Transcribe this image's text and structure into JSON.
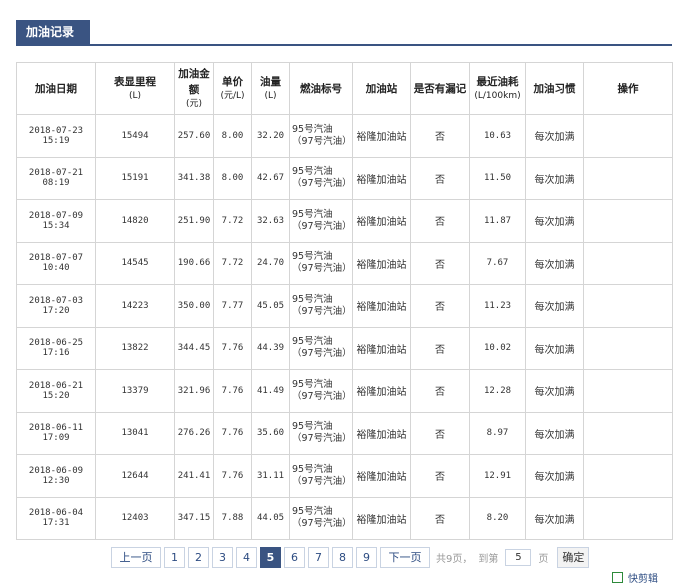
{
  "section_title": "加油记录",
  "columns": [
    {
      "label": "加油日期",
      "unit": ""
    },
    {
      "label": "表显里程",
      "unit": "(L)"
    },
    {
      "label": "加油金额",
      "unit": "(元)"
    },
    {
      "label": "单价",
      "unit": "(元/L)"
    },
    {
      "label": "油量",
      "unit": "(L)"
    },
    {
      "label": "燃油标号",
      "unit": ""
    },
    {
      "label": "加油站",
      "unit": ""
    },
    {
      "label": "是否有漏记",
      "unit": ""
    },
    {
      "label": "最近油耗",
      "unit": "(L/100km)"
    },
    {
      "label": "加油习惯",
      "unit": ""
    },
    {
      "label": "操作",
      "unit": ""
    }
  ],
  "rows": [
    {
      "date": "2018-07-23 15:19",
      "odometer": "15494",
      "amount": "257.60",
      "price": "8.00",
      "volume": "32.20",
      "fuel": "95号汽油（97号汽油）",
      "station": "裕隆加油站",
      "missed": "否",
      "consumption": "10.63",
      "habit": "每次加满",
      "action": ""
    },
    {
      "date": "2018-07-21 08:19",
      "odometer": "15191",
      "amount": "341.38",
      "price": "8.00",
      "volume": "42.67",
      "fuel": "95号汽油（97号汽油）",
      "station": "裕隆加油站",
      "missed": "否",
      "consumption": "11.50",
      "habit": "每次加满",
      "action": ""
    },
    {
      "date": "2018-07-09 15:34",
      "odometer": "14820",
      "amount": "251.90",
      "price": "7.72",
      "volume": "32.63",
      "fuel": "95号汽油（97号汽油）",
      "station": "裕隆加油站",
      "missed": "否",
      "consumption": "11.87",
      "habit": "每次加满",
      "action": ""
    },
    {
      "date": "2018-07-07 10:40",
      "odometer": "14545",
      "amount": "190.66",
      "price": "7.72",
      "volume": "24.70",
      "fuel": "95号汽油（97号汽油）",
      "station": "裕隆加油站",
      "missed": "否",
      "consumption": "7.67",
      "habit": "每次加满",
      "action": ""
    },
    {
      "date": "2018-07-03 17:20",
      "odometer": "14223",
      "amount": "350.00",
      "price": "7.77",
      "volume": "45.05",
      "fuel": "95号汽油（97号汽油）",
      "station": "裕隆加油站",
      "missed": "否",
      "consumption": "11.23",
      "habit": "每次加满",
      "action": ""
    },
    {
      "date": "2018-06-25 17:16",
      "odometer": "13822",
      "amount": "344.45",
      "price": "7.76",
      "volume": "44.39",
      "fuel": "95号汽油（97号汽油）",
      "station": "裕隆加油站",
      "missed": "否",
      "consumption": "10.02",
      "habit": "每次加满",
      "action": ""
    },
    {
      "date": "2018-06-21 15:20",
      "odometer": "13379",
      "amount": "321.96",
      "price": "7.76",
      "volume": "41.49",
      "fuel": "95号汽油（97号汽油）",
      "station": "裕隆加油站",
      "missed": "否",
      "consumption": "12.28",
      "habit": "每次加满",
      "action": ""
    },
    {
      "date": "2018-06-11 17:09",
      "odometer": "13041",
      "amount": "276.26",
      "price": "7.76",
      "volume": "35.60",
      "fuel": "95号汽油（97号汽油）",
      "station": "裕隆加油站",
      "missed": "否",
      "consumption": "8.97",
      "habit": "每次加满",
      "action": ""
    },
    {
      "date": "2018-06-09 12:30",
      "odometer": "12644",
      "amount": "241.41",
      "price": "7.76",
      "volume": "31.11",
      "fuel": "95号汽油（97号汽油）",
      "station": "裕隆加油站",
      "missed": "否",
      "consumption": "12.91",
      "habit": "每次加满",
      "action": ""
    },
    {
      "date": "2018-06-04 17:31",
      "odometer": "12403",
      "amount": "347.15",
      "price": "7.88",
      "volume": "44.05",
      "fuel": "95号汽油（97号汽油）",
      "station": "裕隆加油站",
      "missed": "否",
      "consumption": "8.20",
      "habit": "每次加满",
      "action": ""
    }
  ],
  "pagination": {
    "prev_label": "上一页",
    "next_label": "下一页",
    "pages": [
      "1",
      "2",
      "3",
      "4",
      "5",
      "6",
      "7",
      "8",
      "9"
    ],
    "current_page": "5",
    "total_text": "共9页，",
    "goto_prefix": "到第",
    "goto_value": "5",
    "goto_suffix": "页",
    "confirm_label": "确定"
  },
  "corner_text": "快剪辑",
  "colors": {
    "accent": "#3a5482",
    "border": "#d5d5d5",
    "pager_border": "#c9d3e2"
  }
}
